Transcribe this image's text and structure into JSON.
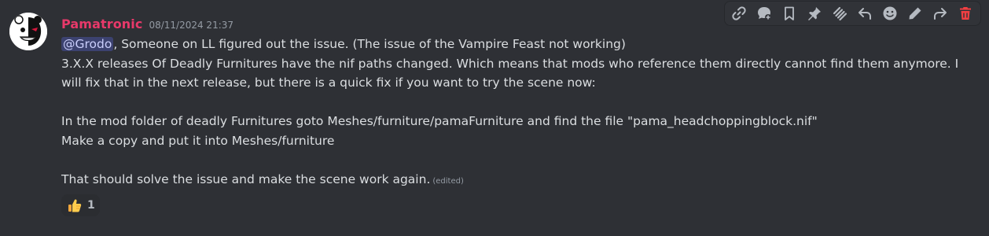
{
  "message": {
    "username": "Pamatronic",
    "timestamp": "08/11/2024 21:37",
    "mention": "@Grodo",
    "line1_rest": ", Someone on LL figured out the issue. (The issue of the Vampire Feast not working)",
    "line2": "3.X.X releases Of Deadly Furnitures have the nif paths changed. Which means that mods who reference them directly cannot find them anymore. I",
    "line3": "will fix that in the next release, but there is a quick fix if you want to try the scene now:",
    "line5": "In the mod folder of deadly Furnitures goto Meshes/furniture/pamaFurniture and find the file \"pama_headchoppingblock.nif\"",
    "line6": "Make a copy and put it into Meshes/furniture",
    "line8": "That should solve the issue and make the scene work again.",
    "edited_label": "(edited)"
  },
  "reaction": {
    "emoji": "thumbs-up",
    "count": "1"
  },
  "toolbar": {
    "buttons": [
      "link-icon",
      "create-thread-icon",
      "bookmark-icon",
      "pin-icon",
      "apps-icon",
      "reply-icon",
      "add-reaction-icon",
      "edit-icon",
      "forward-icon",
      "delete-icon"
    ],
    "danger_color": "#f23f42",
    "icon_color": "#b5bac1"
  },
  "colors": {
    "background": "#2e3035",
    "username": "#e8396a",
    "mention_bg": "#3c4270"
  }
}
